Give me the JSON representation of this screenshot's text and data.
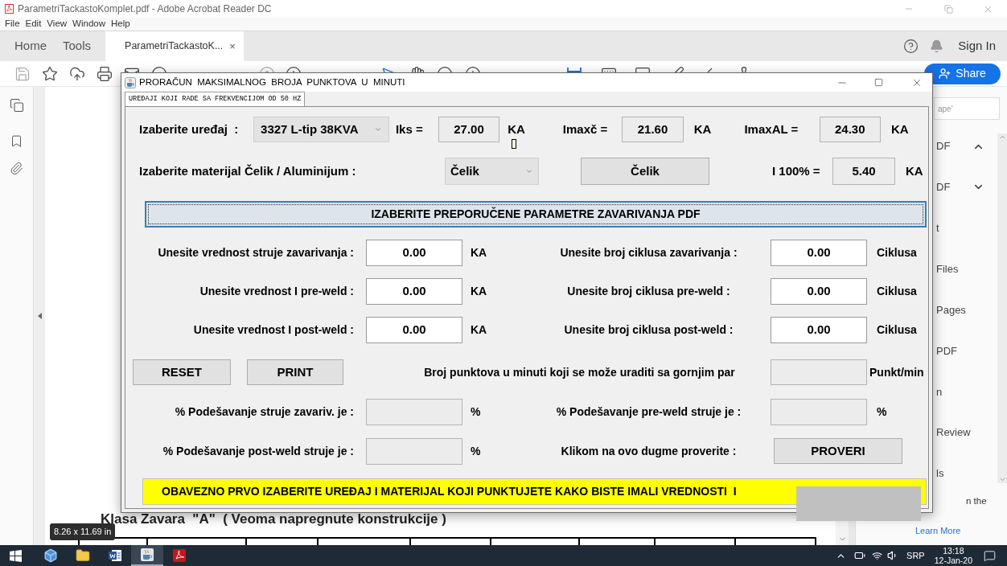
{
  "acrobat": {
    "title": "ParametriTackastoKomplet.pdf - Adobe Acrobat Reader DC",
    "menu": [
      "File",
      "Edit",
      "View",
      "Window",
      "Help"
    ],
    "tabs": [
      {
        "label": "Home",
        "selected": false
      },
      {
        "label": "Tools",
        "selected": false
      },
      {
        "label": "ParametriTackastoK...",
        "selected": true,
        "close": "×"
      }
    ],
    "sign_in": "Sign In",
    "share": "Share",
    "document": {
      "heading": "Klasa Zavara  \"A\"  ( Veoma napregnute konstrukcije )",
      "page_size": "8.26 x 11.69 in"
    },
    "right_panel": {
      "search_placeholder": "ape'",
      "items": [
        {
          "label": "DF",
          "expanded": true
        },
        {
          "label": "DF",
          "expanded": false
        },
        {
          "label": "t"
        },
        {
          "label": "Files"
        },
        {
          "label": "Pages"
        },
        {
          "label": "PDF"
        },
        {
          "label": "n"
        },
        {
          "label": "Review"
        },
        {
          "label": "ls"
        }
      ],
      "note": "n the",
      "link": "Learn More"
    }
  },
  "dialog": {
    "title": "PRORAČUN  MAKSIMALNOG  BROJA  PUNKTOVA  U  MINUTI",
    "tab": {
      "label": "UREĐAJI KOJI RADE SA FREKVENCIJOM OD 50 HZ",
      "selected": true
    },
    "device": {
      "label": "Izaberite uređaj  :",
      "value": "3327 L-tip 38KVA"
    },
    "readings": [
      {
        "label": "Iks =",
        "value": "27.00",
        "unit": "KA",
        "indicator": true
      },
      {
        "label": "Imaxč =",
        "value": "21.60",
        "unit": "KA",
        "indicator": false
      },
      {
        "label": "ImaxAL =",
        "value": "24.30",
        "unit": "KA",
        "indicator": false
      }
    ],
    "material": {
      "label": "Izaberite materijal Čelik / Aluminijum :",
      "value": "Čelik",
      "button": "Čelik"
    },
    "current_100": {
      "label": "I 100% =",
      "value": "5.40",
      "unit": "KA"
    },
    "params_button": "IZABERITE PREPORUČENE PARAMETRE ZAVARIVANJA PDF",
    "param_rows": [
      {
        "left": {
          "kind": "input",
          "label": "Unesite vrednost struje zavarivanja :",
          "value": "0.00",
          "unit": "KA"
        },
        "right": {
          "kind": "input",
          "label": "Unesite broj ciklusa zavarivanja :",
          "value": "0.00",
          "unit": "Ciklusa"
        }
      },
      {
        "left": {
          "kind": "input",
          "label": "Unesite vrednost I pre-weld :",
          "value": "0.00",
          "unit": "KA"
        },
        "right": {
          "kind": "input",
          "label": "Unesite broj ciklusa pre-weld :",
          "value": "0.00",
          "unit": "Ciklusa"
        }
      },
      {
        "left": {
          "kind": "input",
          "label": "Unesite vrednost I post-weld :",
          "value": "0.00",
          "unit": "KA"
        },
        "right": {
          "kind": "input",
          "label": "Unesite broj ciklusa post-weld :",
          "value": "0.00",
          "unit": "Ciklusa"
        }
      }
    ],
    "buttons": [
      "RESET",
      "PRINT"
    ],
    "result": {
      "label": "Broj punktova u minuti koji se može uraditi sa gornjim par",
      "unit": "Punkt/min"
    },
    "percent_rows": [
      {
        "left": {
          "kind": "output",
          "label": "% Podešavanje struje zavariv. je :",
          "unit": "%"
        },
        "right": {
          "kind": "output",
          "label": "% Podešavanje pre-weld struje je :",
          "unit": "%"
        }
      },
      {
        "left": {
          "kind": "output",
          "label": "% Podešavanje post-weld struje je :",
          "unit": "%"
        },
        "right": {
          "kind": "button",
          "label": "Klikom na ovo dugme proverite :",
          "button": "PROVERI"
        }
      }
    ],
    "banner": "OBAVEZNO PRVO IZABERITE UREĐAJ I MATERIJAL KOJI PUNKTUJETE KAKO BISTE IMALI VREDNOSTI  I"
  },
  "taskbar": {
    "apps": [
      {
        "kind": "cube",
        "selected": false
      },
      {
        "kind": "folder",
        "selected": false
      },
      {
        "kind": "word",
        "selected": false
      },
      {
        "kind": "java",
        "selected": true
      },
      {
        "kind": "acrobat",
        "selected": false
      }
    ],
    "language": "SRP",
    "time": "13:18",
    "date": "12-Jan-20"
  }
}
